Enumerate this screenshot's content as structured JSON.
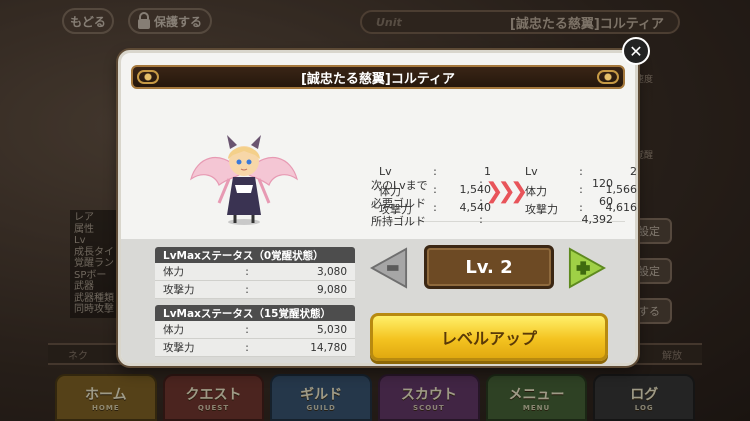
{
  "background": {
    "back_button": "もどる",
    "lock_button": "保護する",
    "unit_tag": "Unit",
    "unit_title": "[誠忠たる慈翼]コルティア",
    "side_list": [
      "レア",
      "属性",
      "Lv",
      "成長タイ",
      "覚醒ラン",
      "SPボー",
      "武器",
      "武器種類",
      "同時攻撃"
    ],
    "right_buttons": [
      "設定",
      "設定",
      "する"
    ],
    "right_fragments": [
      "臣速度",
      "要覚醒"
    ],
    "bottom_bar": {
      "left": "ネク",
      "right": "解放"
    }
  },
  "nav": [
    {
      "label": "ホーム",
      "sub": "HOME"
    },
    {
      "label": "クエスト",
      "sub": "QUEST"
    },
    {
      "label": "ギルド",
      "sub": "GUILD"
    },
    {
      "label": "スカウト",
      "sub": "SCOUT"
    },
    {
      "label": "メニュー",
      "sub": "MENU"
    },
    {
      "label": "ログ",
      "sub": "LOG"
    }
  ],
  "modal": {
    "title": "[誠忠たる慈翼]コルティア",
    "close": "✕",
    "current": {
      "rows": [
        {
          "label": "Lv",
          "sep": ":",
          "value": "1"
        },
        {
          "label": "体力",
          "sep": ":",
          "value": "1,540"
        },
        {
          "label": "攻撃力",
          "sep": ":",
          "value": "4,540"
        }
      ]
    },
    "arrow": "❯❯❯",
    "next": {
      "rows": [
        {
          "label": "Lv",
          "sep": ":",
          "value": "2"
        },
        {
          "label": "体力",
          "sep": ":",
          "value": "1,566"
        },
        {
          "label": "攻撃力",
          "sep": ":",
          "value": "4,616"
        }
      ]
    },
    "gold": [
      {
        "label": "次のLvまで",
        "sep": ":",
        "value": "120"
      },
      {
        "label": "必要ゴルド",
        "sep": ":",
        "value": "60"
      },
      {
        "label": "所持ゴルド",
        "sep": ":",
        "value": "4,392"
      }
    ],
    "status_boxes": [
      {
        "header": "LvMaxステータス（0覚醒状態）",
        "rows": [
          {
            "label": "体力",
            "sep": ":",
            "value": "3,080"
          },
          {
            "label": "攻撃力",
            "sep": ":",
            "value": "9,080"
          }
        ]
      },
      {
        "header": "LvMaxステータス（15覚醒状態）",
        "rows": [
          {
            "label": "体力",
            "sep": ":",
            "value": "5,030"
          },
          {
            "label": "攻撃力",
            "sep": ":",
            "value": "14,780"
          }
        ]
      }
    ],
    "level_selector": {
      "value": "Lv. 2",
      "minus_color": "#9a9a9a",
      "plus_color": "#8fc53a"
    },
    "level_up_button": "レベルアップ"
  }
}
